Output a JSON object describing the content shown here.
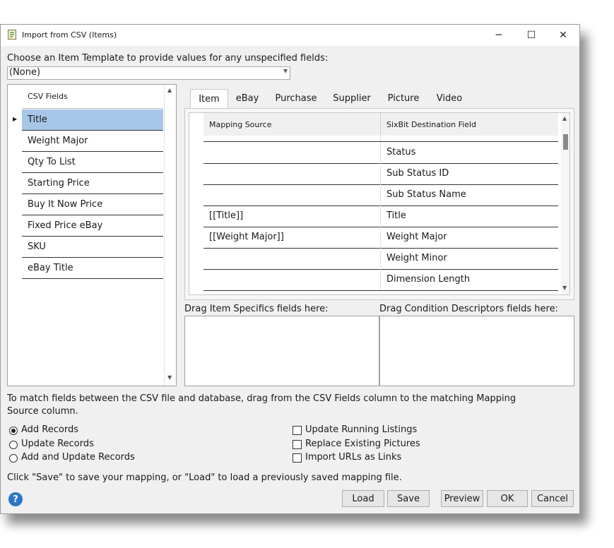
{
  "window": {
    "title": "Import from CSV (Items)",
    "minimize_glyph": "─",
    "maximize_glyph": "☐",
    "close_glyph": "✕"
  },
  "template": {
    "label": "Choose an Item Template to provide values for any unspecified fields:",
    "value": "(None)"
  },
  "csv_fields": {
    "header": "CSV Fields",
    "items": [
      "Title",
      "Weight Major",
      "Qty To List",
      "Starting Price",
      "Buy It Now Price",
      "Fixed Price eBay",
      "SKU",
      "eBay Title"
    ],
    "selected_index": 0
  },
  "tabs": [
    "Item",
    "eBay",
    "Purchase",
    "Supplier",
    "Picture",
    "Video"
  ],
  "active_tab": "Item",
  "mapping_grid": {
    "col_source": "Mapping Source",
    "col_dest": "SixBit Destination Field",
    "rows": [
      {
        "source": "",
        "dest": "Status"
      },
      {
        "source": "",
        "dest": "Sub Status ID"
      },
      {
        "source": "",
        "dest": "Sub Status Name"
      },
      {
        "source": "[[Title]]",
        "dest": "Title"
      },
      {
        "source": "[[Weight Major]]",
        "dest": "Weight Major"
      },
      {
        "source": "",
        "dest": "Weight Minor"
      },
      {
        "source": "",
        "dest": "Dimension Length"
      }
    ]
  },
  "drop_zones": {
    "item_specifics": "Drag Item Specifics fields here:",
    "condition_descriptors": "Drag Condition Descriptors fields here:"
  },
  "instructions": {
    "line1": "To match fields between the CSV file and database, drag from the CSV Fields column to the matching Mapping",
    "line2": "Source column.",
    "save_hint": "Click \"Save\" to save your mapping, or \"Load\" to load a previously saved mapping file."
  },
  "record_modes": {
    "options": [
      "Add Records",
      "Update Records",
      "Add and Update Records"
    ],
    "selected": "Add Records"
  },
  "options": {
    "update_running_listings": {
      "label": "Update Running Listings",
      "checked": false
    },
    "replace_existing_pictures": {
      "label": "Replace Existing Pictures",
      "checked": false
    },
    "import_urls_as_links": {
      "label": "Import URLs as Links",
      "checked": false
    }
  },
  "buttons": {
    "load": "Load",
    "save": "Save",
    "preview": "Preview",
    "ok": "OK",
    "cancel": "Cancel",
    "help": "?"
  },
  "colors": {
    "selection": "#a8c7e8",
    "help_icon": "#2a78c5"
  }
}
